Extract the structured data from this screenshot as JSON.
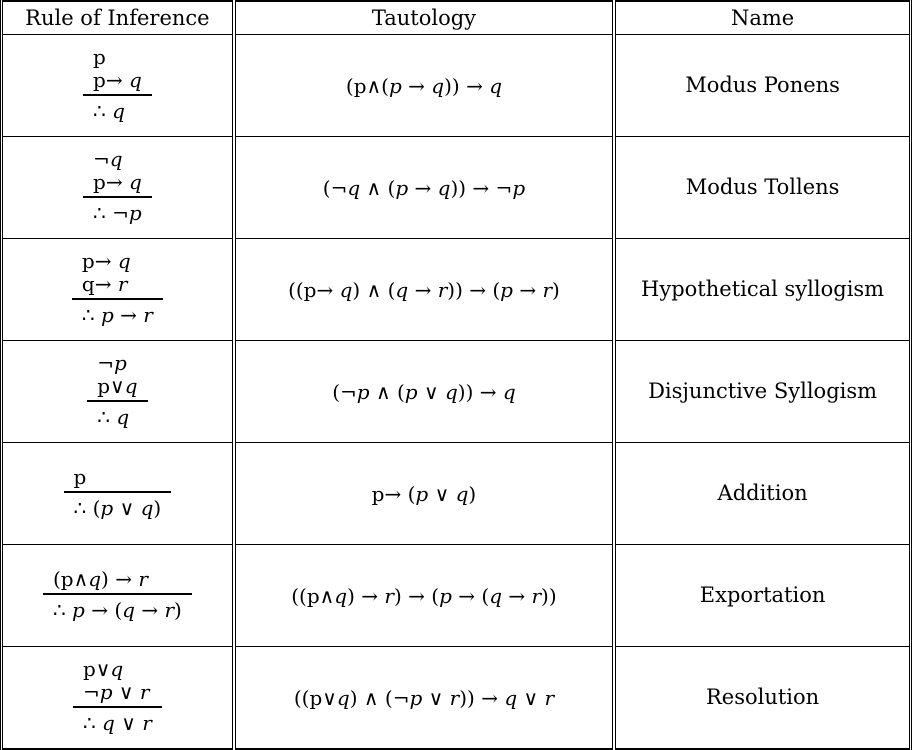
{
  "table": {
    "headers": {
      "rule": "Rule of Inference",
      "tautology": "Tautology",
      "name": "Name"
    },
    "rows": [
      {
        "name": "Modus Ponens",
        "premises": [
          "p",
          "p→ q"
        ],
        "conclusion": "∴ q",
        "tautology": "(p∧(p → q)) → q"
      },
      {
        "name": "Modus Tollens",
        "premises": [
          "¬q",
          "p→ q"
        ],
        "conclusion": "∴ ¬p",
        "tautology": "(¬q ∧ (p → q)) → ¬p"
      },
      {
        "name": "Hypothetical syllogism",
        "premises": [
          "p→ q",
          "q→ r"
        ],
        "conclusion": "∴ p → r",
        "tautology": "((p→ q) ∧ (q → r)) → (p → r)"
      },
      {
        "name": "Disjunctive Syllogism",
        "premises": [
          "¬p",
          "p∨q"
        ],
        "conclusion": "∴ q",
        "tautology": "(¬p ∧ (p ∨ q)) → q"
      },
      {
        "name": "Addition",
        "premises": [
          "p"
        ],
        "conclusion": "∴ (p ∨ q)",
        "tautology": "p→ (p ∨ q)"
      },
      {
        "name": "Exportation",
        "premises": [
          "(p∧q) → r"
        ],
        "conclusion": "∴ p → (q → r)",
        "tautology": "((p∧q) → r) → (p → (q → r))"
      },
      {
        "name": "Resolution",
        "premises": [
          "p∨q",
          "¬p ∨ r"
        ],
        "conclusion": "∴ q ∨ r",
        "tautology": "((p∨q) ∧ (¬p ∨ r)) → q ∨ r"
      }
    ]
  }
}
